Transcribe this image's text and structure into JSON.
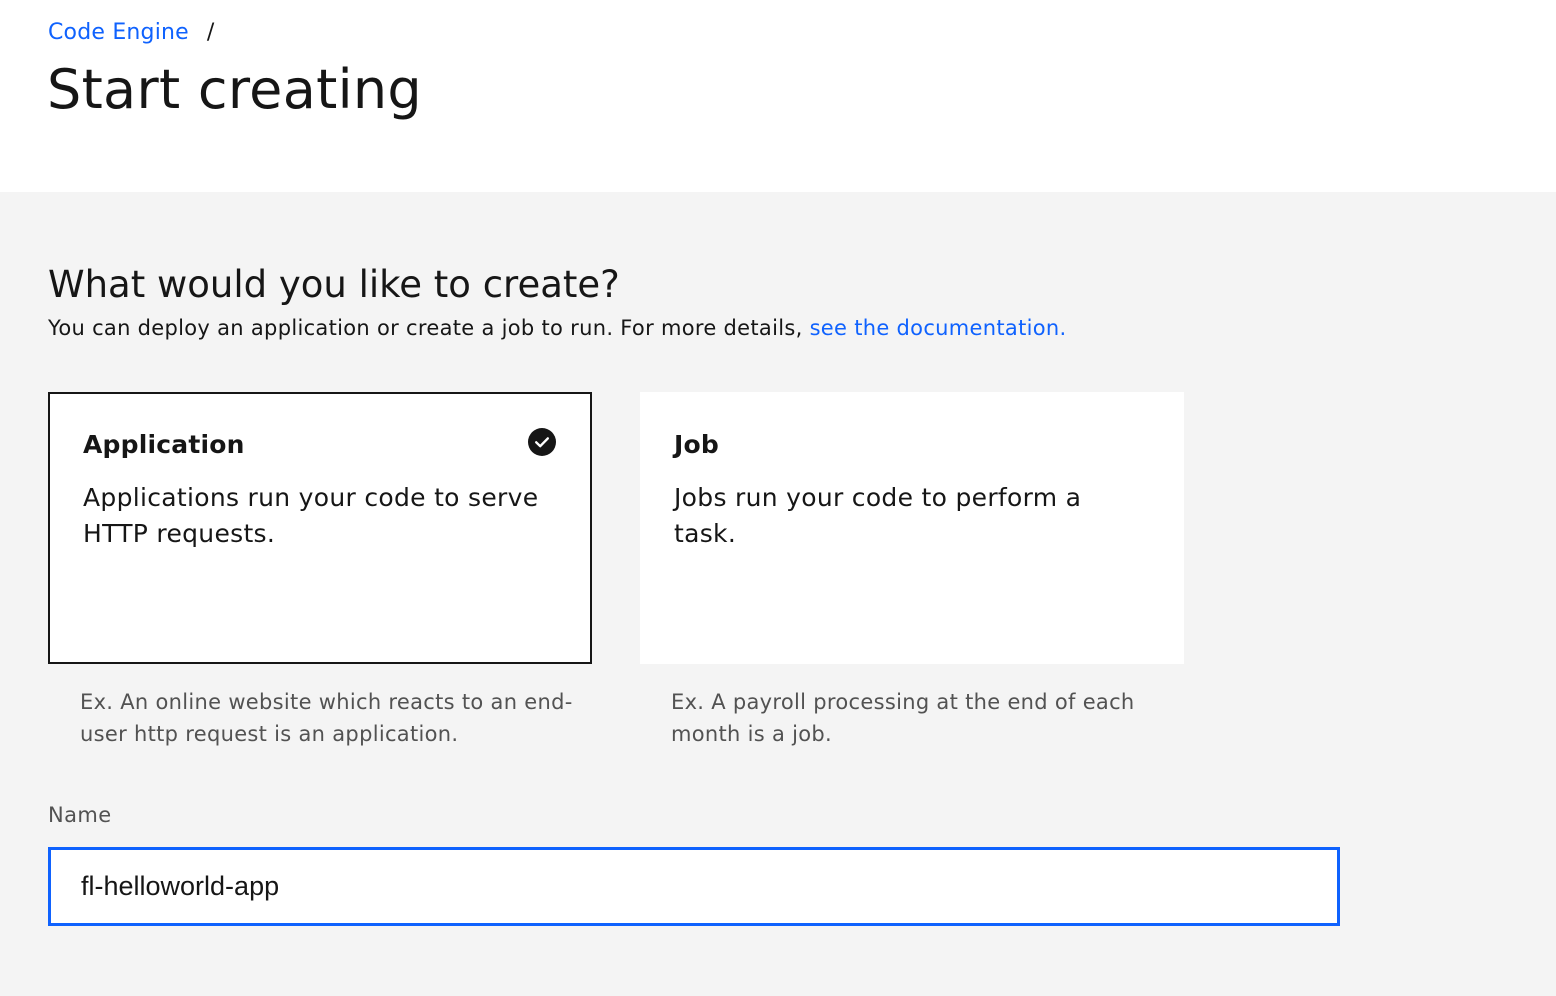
{
  "breadcrumb": {
    "link": "Code Engine",
    "separator": "/"
  },
  "page": {
    "title": "Start creating"
  },
  "section": {
    "heading": "What would you like to create?",
    "description": "You can deploy an application or create a job to run. For more details, ",
    "doc_link": "see the documentation."
  },
  "tiles": [
    {
      "title": "Application",
      "description": "Applications run your code to serve HTTP requests.",
      "example": "Ex. An online website which reacts to an end-user http request is an application.",
      "selected": true,
      "icon": "checkmark-filled-icon"
    },
    {
      "title": "Job",
      "description": "Jobs run your code to perform a task.",
      "example": "Ex. A payroll processing at the end of each month is a job.",
      "selected": false
    }
  ],
  "name_field": {
    "label": "Name",
    "value": "fl-helloworld-app"
  },
  "colors": {
    "link": "#0f62fe",
    "focus": "#0f62fe",
    "text": "#161616",
    "secondary_text": "#525252",
    "background": "#f4f4f4",
    "surface": "#ffffff"
  }
}
